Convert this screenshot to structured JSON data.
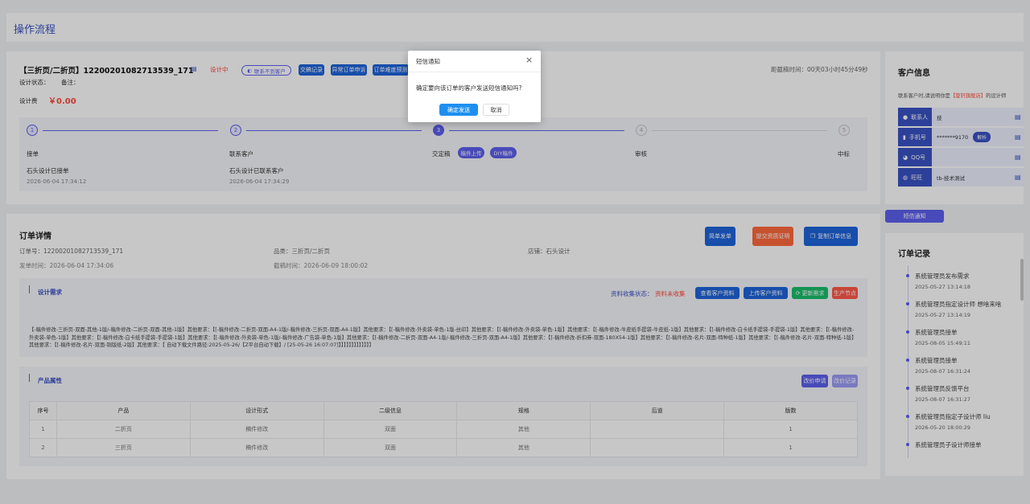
{
  "page_title": "操作流程",
  "order": {
    "title_prefix": "【三折页/二折页】",
    "order_no_title": "12200201082713539_171",
    "status": "设计中",
    "buttons": {
      "contact_failed": "联系不到客户",
      "draft_record": "交稿记录",
      "abnormal_apply": "异常订单申诉",
      "difficulty": "订单难度预测"
    },
    "design_status_label": "设计状态：",
    "remark_label": "备注：",
    "design_fee_label": "设计费",
    "design_fee_value": "￥0.00",
    "deadline_text": "距截稿时间：00天03小时45分49秒"
  },
  "steps": [
    {
      "num": "1",
      "label": "接单",
      "desc": "石头设计已接单",
      "time": "2026-06-04 17:34:12"
    },
    {
      "num": "2",
      "label": "联系客户",
      "desc": "石头设计已联系客户",
      "time": "2026-06-04 17:34:29"
    },
    {
      "num": "3",
      "label": "交定稿",
      "tag1": "稿件上传",
      "tag2": "DIY稿件"
    },
    {
      "num": "4",
      "label": "审核"
    },
    {
      "num": "5",
      "label": "中标"
    }
  ],
  "detail": {
    "title": "订单详情",
    "order_no": "订单号：12200201082713539_171",
    "category": "品类：三折页/二折页",
    "shop": "店铺：石头设计",
    "send_time": "发单时间：2026-06-04 17:34:06",
    "deadline": "截稿时间：2026-06-09 18:00:02",
    "btn_simple_send": "简单发单",
    "btn_submit_proof": "提交资质证明",
    "btn_copy_info": "复制订单信息"
  },
  "design_req": {
    "title": "设计需求",
    "collect_label": "资料收集状态：",
    "collect_value": "资料未收集",
    "btn_view": "查看客户资料",
    "btn_upload": "上传客户资料",
    "btn_update": "更新需求",
    "btn_produce": "生产节点",
    "text": "【-稿件修改-三折页-双面-其他-1版/-稿件修改-二折页-双面-其他-1版】其他要求：【[-稿件修改-二折页-双面-A4-1版/-稿件修改-三折页-双面-A4-1版】其他要求：【[-稿件修改-外卖袋-单色-1版-丝印】其他要求：【[-稿件修改-外卖袋-单色-1版】其他要求：【[-稿件修改-牛皮纸手提袋-牛皮纸-1版】其他要求：【[-稿件修改-白卡纸手提袋-手提袋-1版】其他要求：【[-稿件修改-外卖袋-单色-1版】其他要求：【[-稿件修改-白卡纸手提袋-手提袋-1版】其他要求：【[-稿件修改-外卖袋-单色-1版/-稿件修改-广告袋-单色-1版】其他要求：【[-稿件修改-二折页-双面-A4-1版/-稿件修改-三折页-双面-A4-1版】其他要求：【[-稿件修改-折扣券-双面-180X54-1版】其他要求：【[-稿件修改-名片-双面-特种纸-1版】其他要求：【[-稿件修改-名片-双面-特种纸-1版】其他要求：【[-稿件修改-名片-双面-铜版纸-2版】其他要求：【 自动下载文件路径:2025-05-26/【Z平台自动下载】/ [25-05-26 16:07:07]】】】】】】】】】】】】】"
  },
  "product": {
    "title": "产品属性",
    "btn_change": "改价申请",
    "btn_record": "改价记录",
    "columns": [
      "序号",
      "产品",
      "设计形式",
      "二级信息",
      "规格",
      "后道",
      "版数"
    ],
    "rows": [
      [
        "1",
        "二折页",
        "稿件修改",
        "双面",
        "其他",
        "",
        "1"
      ],
      [
        "2",
        "三折页",
        "稿件修改",
        "双面",
        "其他",
        "",
        "1"
      ]
    ]
  },
  "customer": {
    "title": "客户信息",
    "note_prefix": "联系客户时,请说明你是",
    "note_shop": "【旋轩旗舰店】",
    "note_suffix": "的设计师",
    "rows": [
      {
        "label": "联系人",
        "value": "技"
      },
      {
        "label": "手机号",
        "value": "*******9170",
        "btn": "解析"
      },
      {
        "label": "QQ号",
        "value": ""
      },
      {
        "label": "旺旺",
        "value": "tb-技术测试"
      }
    ],
    "sms_button": "短信通知"
  },
  "records": {
    "title": "订单记录",
    "items": [
      {
        "text": "系统管理员发布需求",
        "time": "2025-05-27 13:14:18"
      },
      {
        "text": "系统管理员指定设计师 想啥来啥",
        "time": "2025-05-27 13:14:19"
      },
      {
        "text": "系统管理员接单",
        "time": "2025-08-05 15:49:11"
      },
      {
        "text": "系统管理员接单",
        "time": "2025-08-07 16:31:24"
      },
      {
        "text": "系统管理员反馈平台",
        "time": "2025-08-07 16:31:27"
      },
      {
        "text": "系统管理员指定子设计师 liu",
        "time": "2026-05-20 18:00:29"
      },
      {
        "text": "系统管理员子设计师接单",
        "time": ""
      }
    ]
  },
  "modal": {
    "title": "短信通知",
    "message": "确定要向该订单的客户发送短信通知吗?",
    "confirm": "确定发送",
    "cancel": "取消"
  }
}
